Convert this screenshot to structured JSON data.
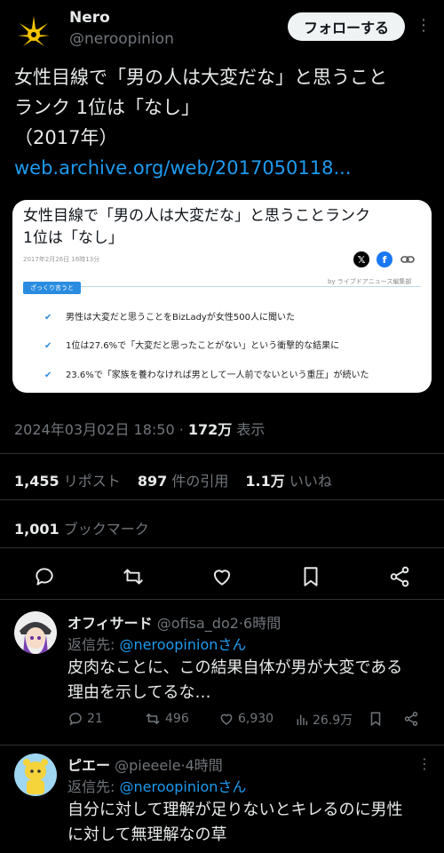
{
  "colors": {
    "background": "#000000",
    "text": "#e7e9ea",
    "muted": "#71767b",
    "link": "#1d9bf0",
    "card_accent": "#2a8ce0"
  },
  "header": {
    "name": "Nero",
    "handle": "@neroopinion",
    "follow_label": "フォローする",
    "more_icon": "more-vertical-icon"
  },
  "tweet": {
    "line1": "女性目線で「男の人は大変だな」と思うこと",
    "line2": "ランク 1位は「なし」",
    "line3": "（2017年）",
    "link": "web.archive.org/web/2017050118..."
  },
  "card": {
    "title_line1": "女性目線で「男の人は大変だな」と思うことランク",
    "title_line2": "1位は「なし」",
    "date": "2017年2月26日 16時13分",
    "source": "by ライブドアニュース編集部",
    "tag": "ざっくり言うと",
    "items": [
      "男性は大変だと思うことをBizLadyが女性500人に聞いた",
      "1位は27.6%で「大変だと思ったことがない」という衝撃的な結果に",
      "23.6%で「家族を養わなければ男として一人前でないという重圧」が続いた"
    ],
    "share_icons": [
      "x-logo-icon",
      "facebook-icon",
      "link-icon"
    ]
  },
  "meta": {
    "timestamp": "2024年03月02日 18:50",
    "separator": " · ",
    "views": "172万",
    "views_label": " 表示"
  },
  "stats": {
    "reposts": "1,455",
    "reposts_label": "リポスト",
    "quotes": "897",
    "quotes_label": "件の引用",
    "likes": "1.1万",
    "likes_label": "いいね",
    "bookmarks": "1,001",
    "bookmarks_label": "ブックマーク"
  },
  "actions": [
    "reply-icon",
    "repost-icon",
    "like-icon",
    "bookmark-icon",
    "share-icon"
  ],
  "replies": [
    {
      "name": "オフィサード",
      "handle": "@ofisa_do2",
      "time": "6時間",
      "reply_to_label": "返信先: ",
      "reply_to": "@neroopinionさん",
      "text_line1": "皮肉なことに、この結果自体が男が大変である",
      "text_line2": "理由を示してるな…",
      "replies_count": "21",
      "reposts_count": "496",
      "likes_count": "6,930",
      "views_count": "26.9万"
    },
    {
      "name": "ピエー",
      "handle": "@pieeele",
      "time": "4時間",
      "reply_to_label": "返信先: ",
      "reply_to": "@neroopinionさん",
      "text_line1": "自分に対して理解が足りないとキレるのに男性",
      "text_line2": "に対して無理解なの草"
    }
  ]
}
